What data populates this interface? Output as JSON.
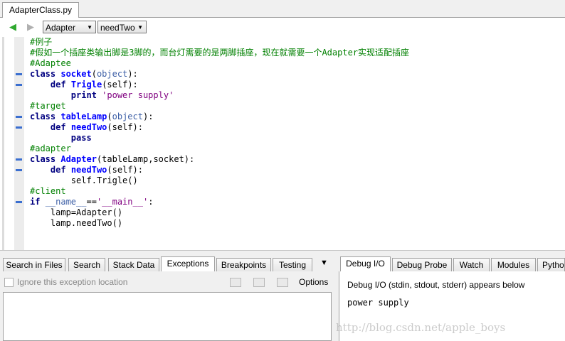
{
  "file_tab": {
    "label": "AdapterClass.py"
  },
  "nav": {
    "class_combo": "Adapter",
    "method_combo": "needTwo"
  },
  "code_lines": [
    "#例子",
    "#假如一个插座类输出脚是3脚的，而台灯需要的是两脚插座，现在就需要一个Adapter实现适配插座",
    "#Adaptee",
    "class socket(object):",
    "    def Trigle(self):",
    "        print 'power supply'",
    "#target",
    "class tableLamp(object):",
    "    def needTwo(self):",
    "        pass",
    "#adapter",
    "class Adapter(tableLamp,socket):",
    "    def needTwo(self):",
    "        self.Trigle()",
    "#client",
    "if __name__=='__main__':",
    "    lamp=Adapter()",
    "    lamp.needTwo()"
  ],
  "left_tabs": [
    "Search in Files",
    "Search",
    "Stack Data",
    "Exceptions",
    "Breakpoints",
    "Testing"
  ],
  "right_tabs": [
    "Debug I/O",
    "Debug Probe",
    "Watch",
    "Modules",
    "Pytho"
  ],
  "exceptions": {
    "ignore_label": "Ignore this exception location",
    "options_label": "Options"
  },
  "debug_io": {
    "note": "Debug I/O (stdin, stdout, stderr) appears below",
    "output": "power supply"
  },
  "watermark": "http://blog.csdn.net/apple_boys",
  "colors": {
    "comment": "#008000",
    "keyword": "#000080",
    "function": "#0000ff",
    "string": "#800080",
    "back_arrow": "#2fa82f",
    "fold_marker": "#3b6fd0"
  }
}
